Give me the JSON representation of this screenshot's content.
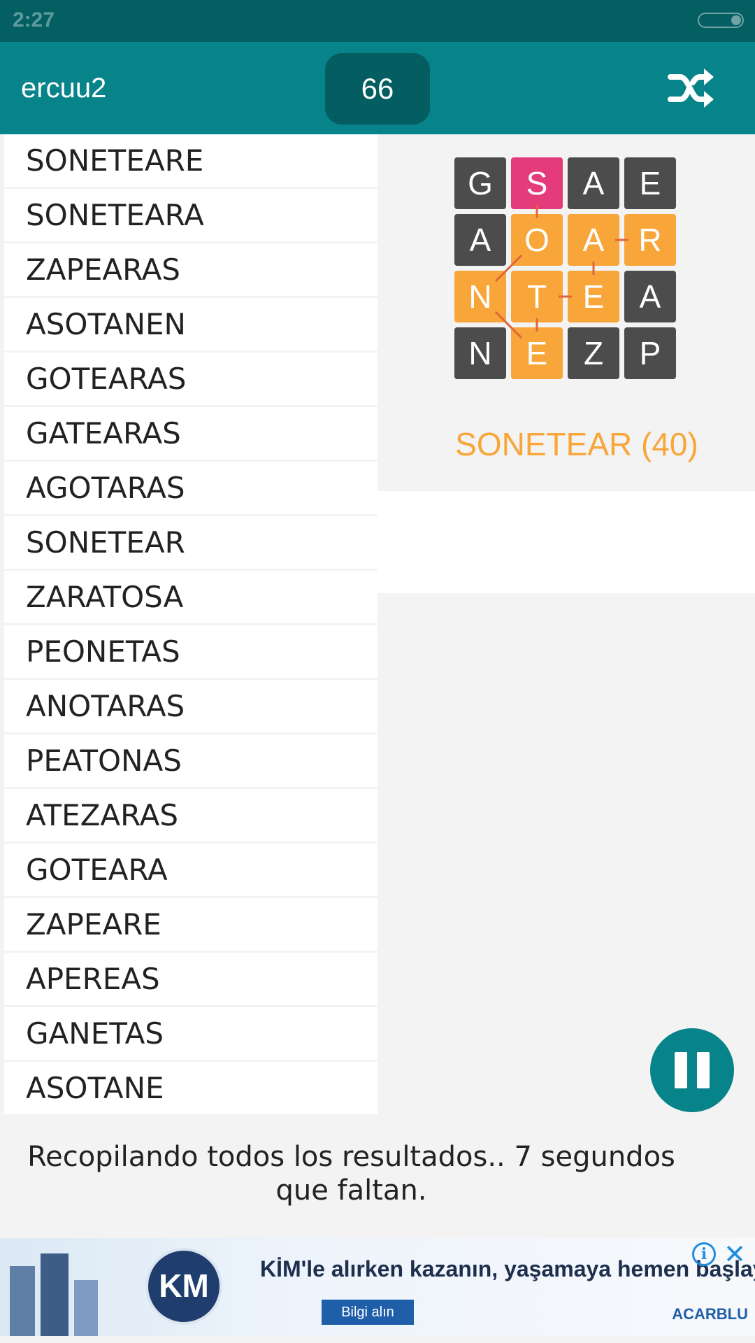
{
  "status_bar": {
    "time": "2:27"
  },
  "app_bar": {
    "username": "ercuu2",
    "score": "66",
    "shuffle_icon": "shuffle-icon"
  },
  "words": [
    "SONETEARE",
    "SONETEARA",
    "ZAPEARAS",
    "ASOTANEN",
    "GOTEARAS",
    "GATEARAS",
    "AGOTARAS",
    "SONETEAR",
    "ZARATOSA",
    "PEONETAS",
    "ANOTARAS",
    "PEATONAS",
    "ATEZARAS",
    "GOTEARA",
    "ZAPEARE",
    "APEREAS",
    "GANETAS",
    "ASOTANE"
  ],
  "board": {
    "rows": [
      [
        "G",
        "S",
        "A",
        "E"
      ],
      [
        "A",
        "O",
        "A",
        "R"
      ],
      [
        "N",
        "T",
        "E",
        "A"
      ],
      [
        "N",
        "E",
        "Z",
        "P"
      ]
    ],
    "highlight": [
      [
        "dark",
        "pink",
        "dark",
        "dark"
      ],
      [
        "dark",
        "orange",
        "orange",
        "orange"
      ],
      [
        "orange",
        "orange",
        "orange",
        "dark"
      ],
      [
        "dark",
        "orange",
        "dark",
        "dark"
      ]
    ],
    "colors": {
      "dark": "#4c4c4c",
      "orange": "#f8a63a",
      "pink": "#e43c7b"
    }
  },
  "current_word": "SONETEAR (40)",
  "status_message": "Recopilando todos los resultados.. 7 segundos que faltan.",
  "ad": {
    "logo": "KM",
    "headline": "KİM'le alırken kazanın, yaşamaya hemen başlayın",
    "cta": "Bilgi alın",
    "brand": "ACARBLU"
  }
}
